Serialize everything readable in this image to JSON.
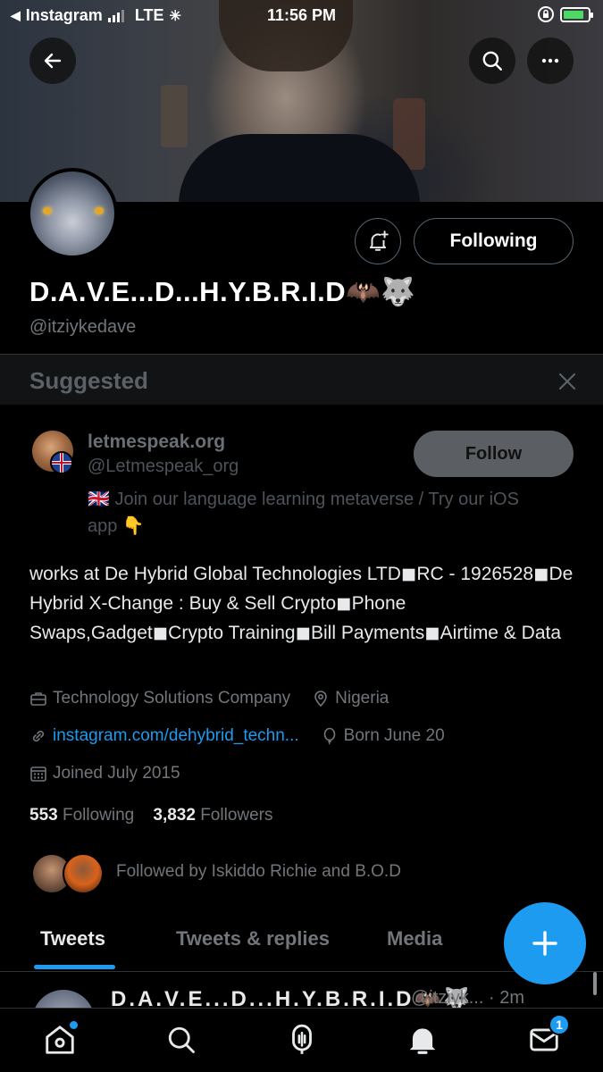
{
  "status_bar": {
    "back_app": "Instagram",
    "network": "LTE",
    "time": "11:56 PM"
  },
  "profile": {
    "display_name": "D.A.V.E...D...H.Y.B.R.I.D🦇🐺",
    "handle": "@itziykedave",
    "following_button": "Following",
    "bio": "works at De Hybrid Global Technologies LTD◼RC - 1926528◼De Hybrid X-Change : Buy & Sell Crypto◼Phone Swaps,Gadget◼Crypto Training◼Bill Payments◼Airtime & Data",
    "category": "Technology Solutions Company",
    "location": "Nigeria",
    "link": "instagram.com/dehybrid_techn...",
    "birthday": "Born June 20",
    "joined": "Joined July 2015",
    "following_count": "553",
    "following_label": "Following",
    "followers_count": "3,832",
    "followers_label": "Followers",
    "followed_by": "Followed by Iskiddo Richie and B.O.D"
  },
  "suggested": {
    "title": "Suggested",
    "name": "letmespeak.org",
    "handle": "@Letmespeak_org",
    "bio": "🇬🇧 Join our language learning metaverse / Try our iOS app 👇",
    "follow_button": "Follow"
  },
  "tabs": [
    "Tweets",
    "Tweets & replies",
    "Media"
  ],
  "tweet_peek": {
    "name": "D.A.V.E...D...H.Y.B.R.I.D🦇🐺",
    "meta": "@itziyk... · 2m"
  },
  "nav": {
    "messages_badge": "1"
  },
  "colors": {
    "accent": "#1d9bf0",
    "background": "#000000",
    "secondary_text": "#71767b"
  }
}
